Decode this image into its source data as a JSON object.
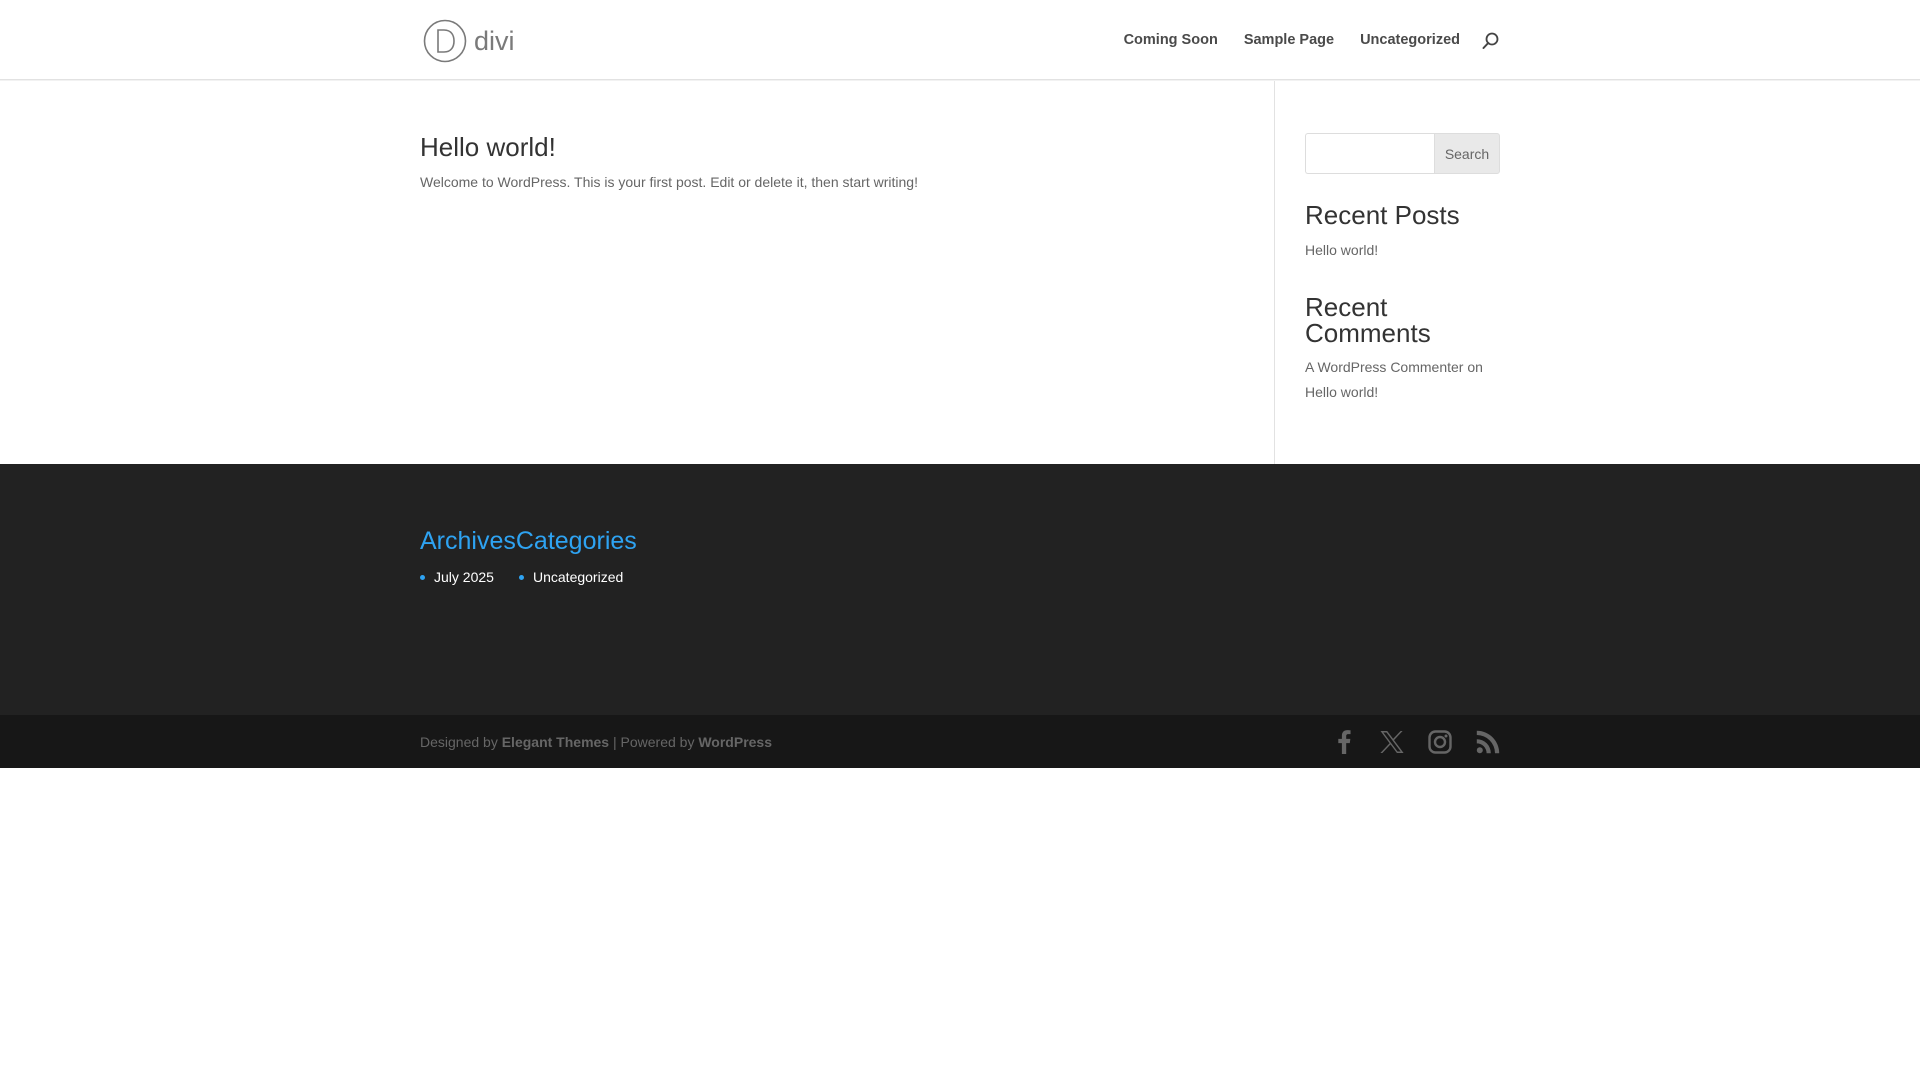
{
  "header": {
    "logo_text": "divi",
    "nav": [
      {
        "label": "Coming Soon"
      },
      {
        "label": "Sample Page"
      },
      {
        "label": "Uncategorized"
      }
    ]
  },
  "post": {
    "title": "Hello world!",
    "excerpt": "Welcome to WordPress. This is your first post. Edit or delete it, then start writing!"
  },
  "sidebar": {
    "search": {
      "placeholder": "",
      "button_label": "Search"
    },
    "recent_posts": {
      "title": "Recent Posts",
      "items": [
        "Hello world!"
      ]
    },
    "recent_comments": {
      "title_line1": "Recent",
      "title_line2": "Comments",
      "author": "A WordPress Commenter",
      "connector": "on",
      "post": "Hello world!"
    }
  },
  "footer_widgets": {
    "archives_title": "Archives",
    "categories_title": "Categories",
    "archives_items": [
      "July 2025"
    ],
    "categories_items": [
      "Uncategorized"
    ]
  },
  "footer_bottom": {
    "designed_by": "Designed by",
    "elegant_themes": "Elegant Themes",
    "separator": "|",
    "powered_by": "Powered by",
    "wordpress": "WordPress",
    "social_icons": [
      "facebook-icon",
      "x-icon",
      "instagram-icon",
      "rss-icon"
    ]
  },
  "colors": {
    "accent": "#2ea3f2",
    "footer_bg": "#222222",
    "bottom_bar_bg": "#171717",
    "text": "#666666",
    "heading": "#333333"
  }
}
